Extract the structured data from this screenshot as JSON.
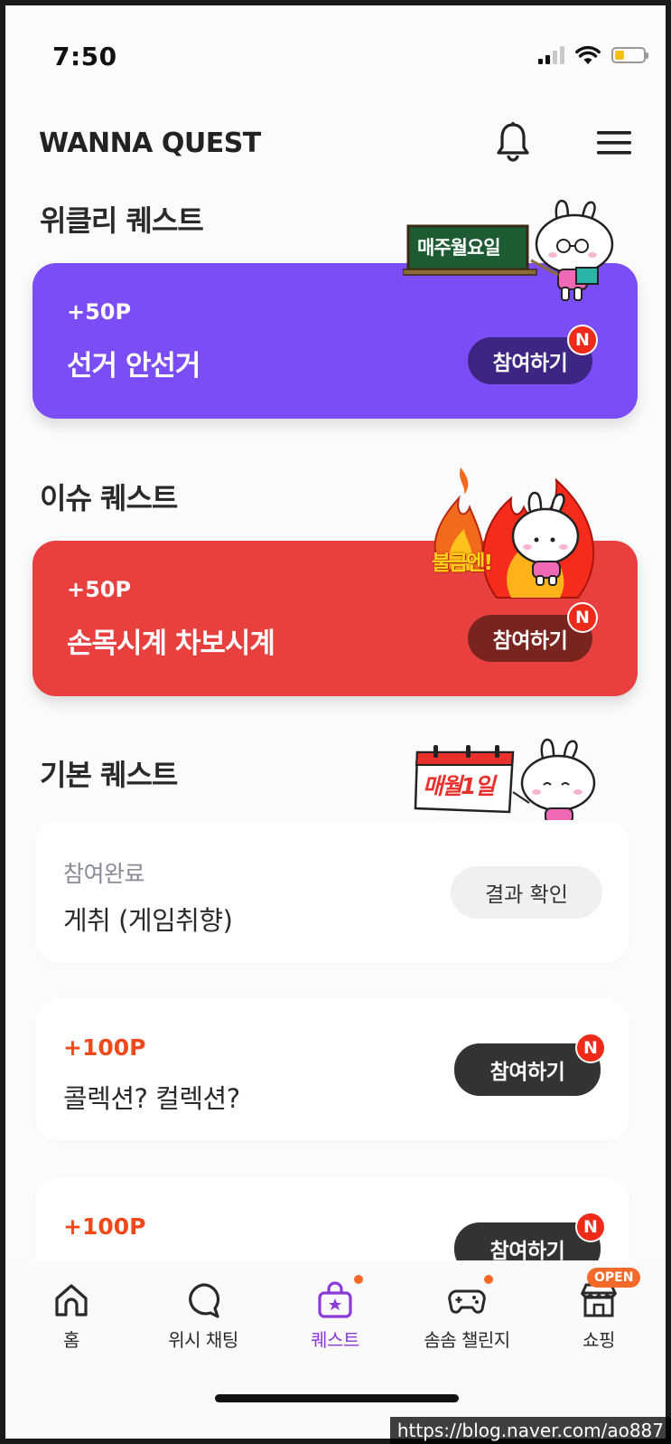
{
  "status_bar": {
    "time": "7:50"
  },
  "header": {
    "title": "WANNA QUEST"
  },
  "colors": {
    "weekly": "#7a4df6",
    "issue": "#e7403f",
    "accent_orange": "#f04a1c",
    "active_nav": "#8b3bd6",
    "join_dark": "#333333"
  },
  "weekly": {
    "section_title": "위클리 퀘스트",
    "badge_text": "매주월요일",
    "card": {
      "points": "+50P",
      "title": "선거 안선거",
      "button": "참여하기",
      "badge": "N"
    }
  },
  "issue": {
    "section_title": "이슈 퀘스트",
    "badge_text": "불금엔!",
    "card": {
      "points": "+50P",
      "title": "손목시계 차보시계",
      "button": "참여하기",
      "badge": "N"
    }
  },
  "basic": {
    "section_title": "기본 퀘스트",
    "badge_text": "매월1일",
    "cards": [
      {
        "status": "참여완료",
        "title": "게취 (게임취향)",
        "button": "결과 확인"
      },
      {
        "points": "+100P",
        "title": "콜렉션? 컬렉션?",
        "button": "참여하기",
        "badge": "N"
      },
      {
        "points": "+100P",
        "button": "참여하기",
        "badge": "N"
      }
    ]
  },
  "nav": {
    "items": [
      {
        "label": "홈",
        "icon": "home-icon"
      },
      {
        "label": "위시 채팅",
        "icon": "chat-icon"
      },
      {
        "label": "퀘스트",
        "icon": "quest-bag-icon",
        "active": true
      },
      {
        "label": "솜솜 챌린지",
        "icon": "gamepad-icon"
      },
      {
        "label": "쇼핑",
        "icon": "store-icon"
      }
    ],
    "open_badge": "OPEN"
  },
  "watermark": "https://blog.naver.com/ao887"
}
